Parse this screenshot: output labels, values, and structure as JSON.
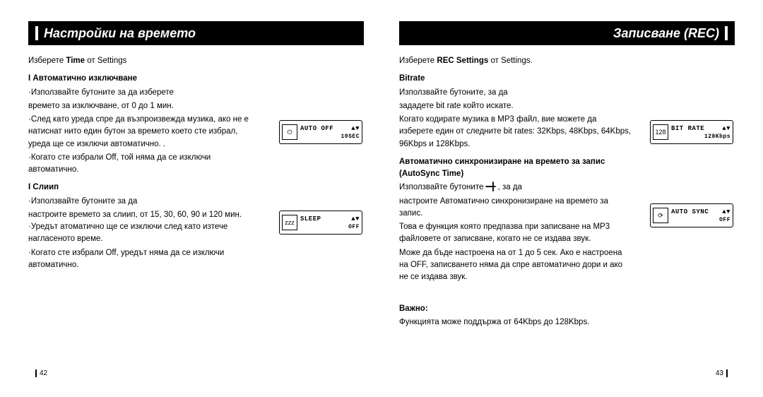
{
  "left": {
    "title": "Настройки на времето",
    "intro_pre": "Изберете ",
    "intro_bold": "Time",
    "intro_post": " от Settings",
    "sectionA_label": "I Автоматично изключване",
    "sectionA_p1": "·Използвайте бутоните         за да изберете",
    "sectionA_p2": "времето за изключване, от 0 до 1 мин.",
    "sectionA_p3": "·След като уреда спре да възпроизвежда музика, ако не е натиснат нито един бутон за времето което сте избрал, уреда ще се изключи автоматично. .",
    "sectionA_p4": "·Когато сте избрали Off, той няма да се изключи автоматично.",
    "sectionB_label": "I Слиип",
    "sectionB_p1": "·Използвайте бутоните        за да",
    "sectionB_p2": "настроите времето за слиип, от 15, 30, 60, 90 и 120 мин. ·Уредът атоматично ще се изключи след като изтече нагласеното време.",
    "sectionB_p3": "·Когато сте избрали Off, уредът няма да се изключи автоматично.",
    "page": "42",
    "lcd1": {
      "icon": "⏻",
      "line1": "AUTO OFF",
      "line2": "10SEC"
    },
    "lcd2": {
      "icon": "zzz",
      "line1": "SLEEP",
      "line2": "OFF"
    }
  },
  "right": {
    "title": "Записване (REC)",
    "intro_pre": "Изберете ",
    "intro_bold": "REC Settings",
    "intro_post": " от Settings.",
    "sectionA_label": "Bitrate",
    "sectionA_p1": "Използвайте бутоните,          за да",
    "sectionA_p2": "зададете bit rate който искате.",
    "sectionA_p3": "Когато кодирате музика в МР3 файл, вие можете да изберете един от следните bit rates: 32Kbps, 48Kbps, 64Kbps, 96Kbps и 128Kbps.",
    "sectionB_label": "Автоматично синхронизиране на времето за запис (AutoSync Time)",
    "sectionB_p1": "Използвайте бутоните ━╋ , за да",
    "sectionB_p2": "настроите Автоматично синхронизиране на времето за запис.",
    "sectionB_p3": "Това е функция която предпазва при записване на МР3 файловете от записване, когато не се издава звук.",
    "sectionB_p4": "Може да бъде настроена на от 1 до 5 сек. Ако е настроена на OFF, записването няма да спре автоматично дори и ако не се издава звук.",
    "sectionC_label": "Важно:",
    "sectionC_p1": "Функцията може поддържа от 64Kbps до 128Kbps.",
    "page": "43",
    "lcd1": {
      "icon": "128",
      "line1": "BIT RATE",
      "line2": "128Kbps"
    },
    "lcd2": {
      "icon": "⟳",
      "line1": "AUTO SYNC",
      "line2": "OFF"
    }
  }
}
